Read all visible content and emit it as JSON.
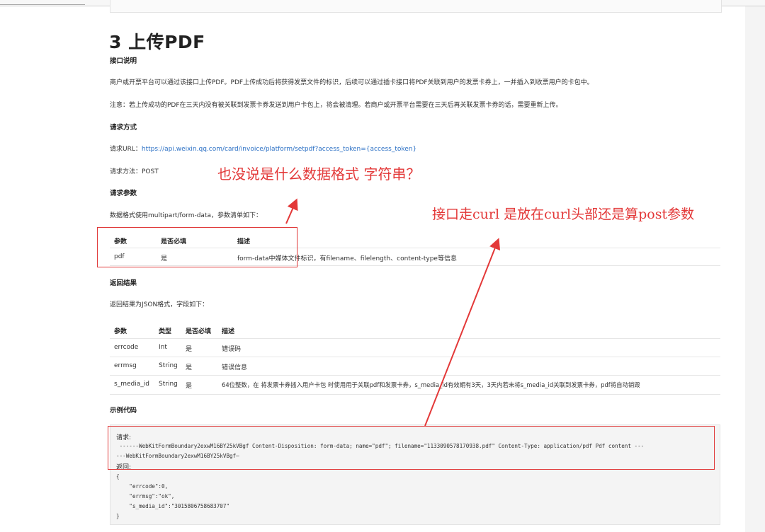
{
  "section": {
    "title": "3 上传PDF",
    "interface_heading": "接口说明",
    "desc1": "商户或开票平台可以通过该接口上传PDF。PDF上传成功后将获得发票文件的标识，后续可以通过插卡接口将PDF关联到用户的发票卡券上，一并插入到收票用户的卡包中。",
    "desc2": "注意：若上传成功的PDF在三天内没有被关联到发票卡券发送到用户卡包上，将会被清理。若商户或开票平台需要在三天后再关联发票卡券的话，需要重新上传。",
    "request_heading": "请求方式",
    "url_label": "请求URL：",
    "url_value": "https://api.weixin.qq.com/card/invoice/platform/setpdf?access_token={access_token}",
    "method_text": "请求方法：POST",
    "params_heading": "请求参数",
    "params_desc": "数据格式使用multipart/form-data，参数清单如下：",
    "result_heading": "返回结果",
    "result_desc": "返回结果为JSON格式，字段如下：",
    "example_heading": "示例代码"
  },
  "request_table": {
    "headers": [
      "参数",
      "是否必填",
      "描述"
    ],
    "rows": [
      [
        "pdf",
        "是",
        "form-data中媒体文件标识，有filename、filelength、content-type等信息"
      ]
    ]
  },
  "result_table": {
    "headers": [
      "参数",
      "类型",
      "是否必填",
      "描述"
    ],
    "rows": [
      [
        "errcode",
        "Int",
        "是",
        "错误码"
      ],
      [
        "errmsg",
        "String",
        "是",
        "错误信息"
      ],
      [
        "s_media_id",
        "String",
        "是",
        "64位整数，在 将发票卡券插入用户卡包 时使用用于关联pdf和发票卡券，s_media_id有效期有3天，3天内若未将s_media_id关联到发票卡券，pdf将自动销毁"
      ]
    ]
  },
  "code": {
    "request_label": "请求:",
    "line1": " ------WebKitFormBoundary2exwM16BY25kVBgf Content-Disposition: form-data; name=\"pdf\"; filename=\"1133090578170938.pdf\" Content-Type: application/pdf Pdf content ---",
    "line2": "---WebKitFormBoundary2exwM16BY25kVBgf—",
    "response_label": "返回:",
    "json_lines": [
      "{",
      "    \"errcode\":0,",
      "    \"errmsg\":\"ok\",",
      "    \"s_media_id\":\"3015806758683707\"",
      "}"
    ]
  },
  "annotations": {
    "note1": "也没说是什么数据格式 字符串？",
    "note2": "接口走curl 是放在curl头部还是算post参数",
    "color": "#e33838"
  }
}
